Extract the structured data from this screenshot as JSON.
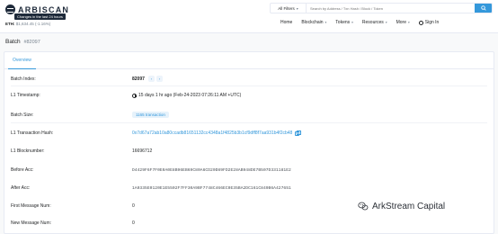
{
  "header": {
    "logo_text": "ARBISCAN",
    "tooltip": "Changes in the last 24 hours",
    "eth_price_label": "ETH:",
    "eth_price_value": "$1,634.45 (-1.16%)",
    "search": {
      "filter_label": "All Filters",
      "placeholder": "Search by Address / Txn Hash / Block / Token"
    },
    "nav": [
      {
        "label": "Home",
        "has_dropdown": false
      },
      {
        "label": "Blockchain",
        "has_dropdown": true
      },
      {
        "label": "Tokens",
        "has_dropdown": true
      },
      {
        "label": "Resources",
        "has_dropdown": true
      },
      {
        "label": "More",
        "has_dropdown": true
      }
    ],
    "sign_in": "Sign In"
  },
  "page": {
    "title": "Batch",
    "batch_number": "#82097"
  },
  "tabs": [
    {
      "label": "Overview",
      "active": true
    }
  ],
  "details": {
    "batch_index": {
      "label": "Batch Index:",
      "value": "82097"
    },
    "l1_timestamp": {
      "label": "L1 Timestamp:",
      "value": "15 days 1 hr ago (Feb-24-2023 07:26:11 AM +UTC)"
    },
    "batch_size": {
      "label": "Batch Size:",
      "value": "1165 transaction"
    },
    "l1_tx_hash": {
      "label": "L1 Transaction Hash:",
      "value": "0x7d67a72ab10a80ccadb81651132cc4348a1f4825b3b1cf9dff8f7aa931b4f2cb48"
    },
    "l1_block": {
      "label": "L1 Blocknumber:",
      "value": "16696712"
    },
    "before_acc": {
      "label": "Before Acc:",
      "value": "D4429F6F7F0E0A0E8B96EB69C80A6CD20D89FD2E28AB948DE7B507D331181E2"
    },
    "after_acc": {
      "label": "After Acc:",
      "value": "1A0335E0120E1E5502F7FF30A9BF7748C466EC0E35BA2DC161C849B6A427651"
    },
    "first_message": {
      "label": "First Message Num:",
      "value": "0"
    },
    "new_message": {
      "label": "New Message Num:",
      "value": "0"
    }
  },
  "pager_icons": [
    "chevron-left-icon",
    "chevron-right-icon"
  ],
  "watermark": {
    "text": "ArkStream Capital"
  },
  "colors": {
    "accent": "#3498db",
    "header_bg": "#ffffff",
    "page_bg": "#f8f9fa",
    "text": "#1e2022",
    "muted": "#77838f"
  }
}
